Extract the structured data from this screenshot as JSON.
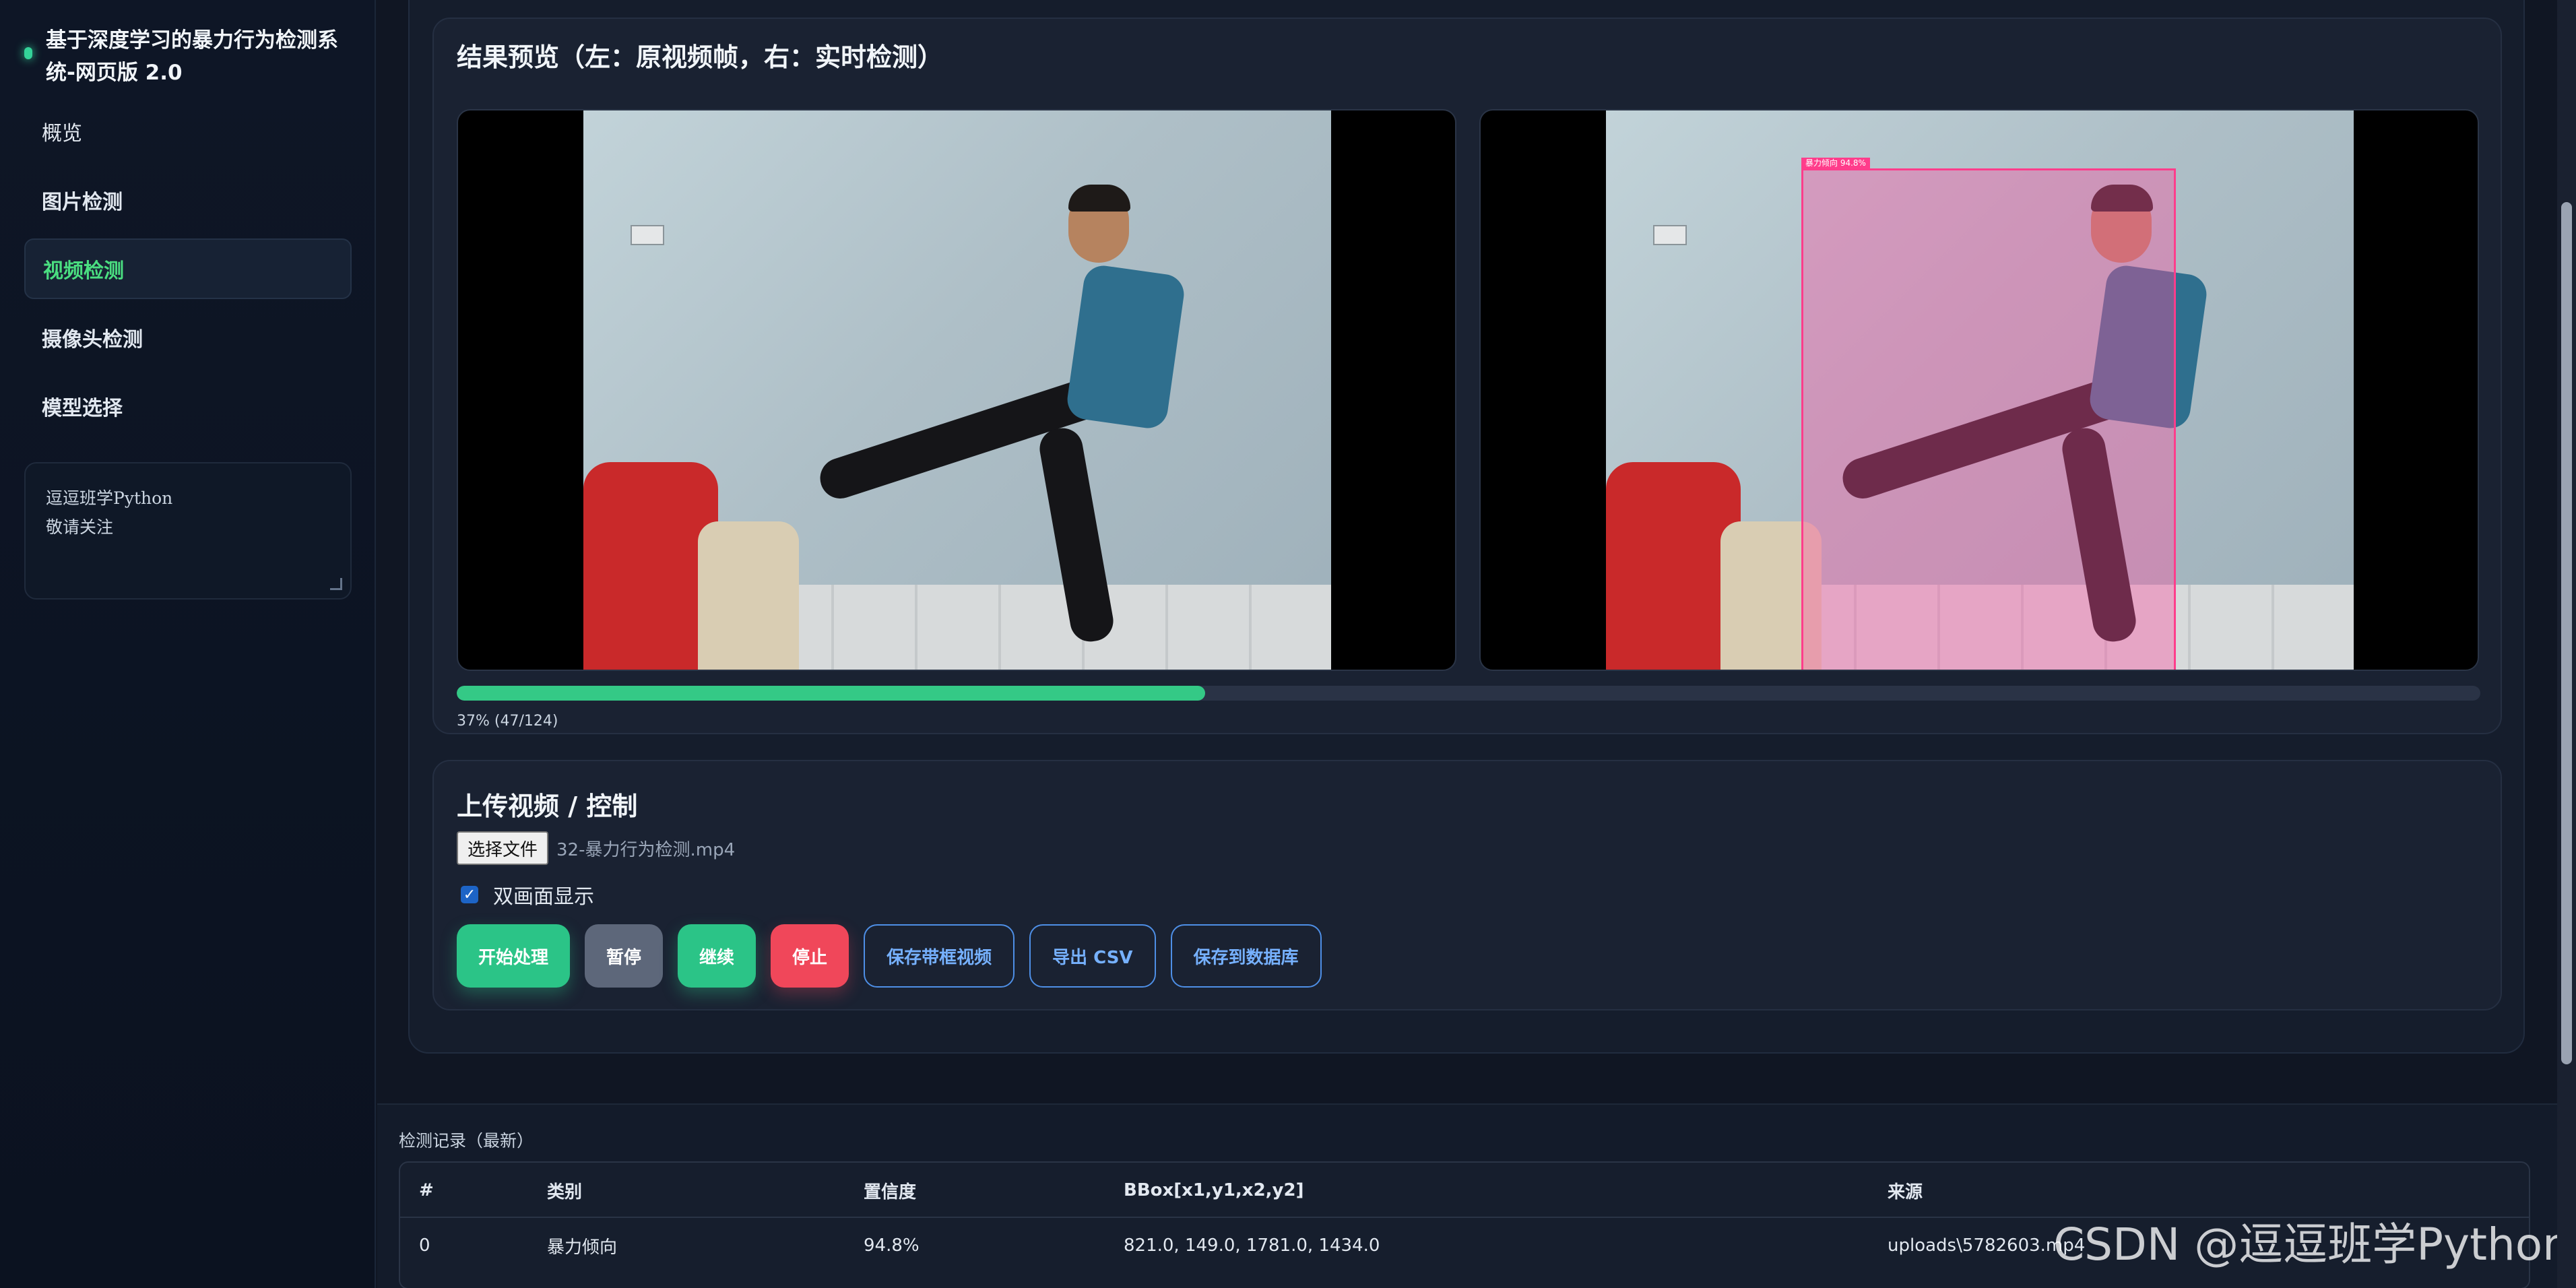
{
  "app": {
    "title": "基于深度学习的暴力行为检测系统-网页版 2.0",
    "accent": "#34d399"
  },
  "sidebar": {
    "items": [
      {
        "label": "概览"
      },
      {
        "label": "图片检测"
      },
      {
        "label": "视频检测",
        "active": true
      },
      {
        "label": "摄像头检测"
      },
      {
        "label": "模型选择"
      }
    ],
    "note": {
      "line1": "逗逗班学Python",
      "line2": "敬请关注"
    }
  },
  "preview": {
    "title": "结果预览（左：原视频帧，右：实时检测）",
    "bbox_label": "暴力倾向 94.8%",
    "progress": {
      "fraction": 0.37,
      "text": "37% (47/124)"
    }
  },
  "upload": {
    "title": "上传视频 / 控制",
    "file_button": "选择文件",
    "file_name": "32-暴力行为检测.mp4",
    "dual_view_label": "双画面显示",
    "dual_view_checked": true,
    "buttons": {
      "start": "开始处理",
      "pause": "暂停",
      "resume": "继续",
      "stop": "停止",
      "save_video": "保存带框视频",
      "export_csv": "导出 CSV",
      "save_db": "保存到数据库"
    }
  },
  "log": {
    "title": "检测记录（最新）",
    "columns": [
      "#",
      "类别",
      "置信度",
      "BBox[x1,y1,x2,y2]",
      "来源"
    ],
    "rows": [
      [
        "0",
        "暴力倾向",
        "94.8%",
        "821.0, 149.0, 1781.0, 1434.0",
        "uploads\\5782603.mp4"
      ]
    ]
  },
  "watermark": "CSDN @逗逗班学Python"
}
